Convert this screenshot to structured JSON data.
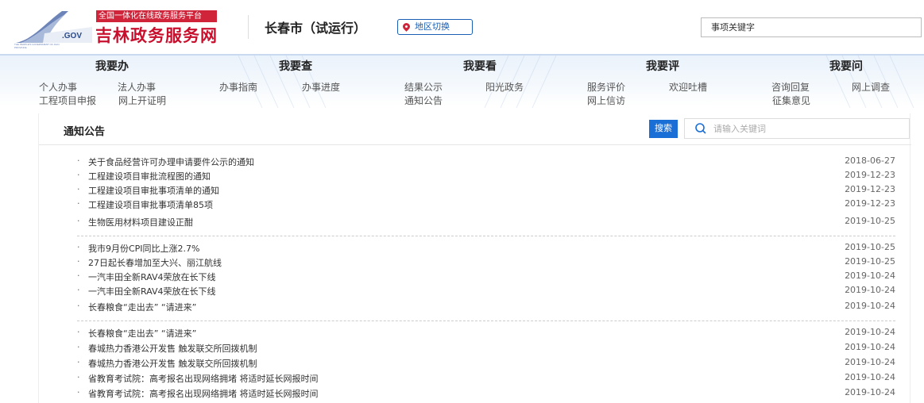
{
  "header": {
    "logo_small_text": ".GOV",
    "logo_tiny_text": "THE PEOPLE'S GOVERNMENT OF JILIN PROVINCE",
    "logo_sub": "全国一体化在线政务服务平台",
    "logo_main": "吉林政务服务网",
    "city": "长春市（试运行）",
    "region_button": "地区切换",
    "search_placeholder": "事项关键字"
  },
  "nav": {
    "categories": [
      "我要办",
      "我要查",
      "我要看",
      "我要评",
      "我要问"
    ],
    "links": {
      "ban": [
        "个人办事",
        "法人办事",
        "工程项目申报",
        "网上开证明"
      ],
      "cha": [
        "办事指南",
        "办事进度"
      ],
      "kan": [
        "结果公示",
        "阳光政务",
        "通知公告"
      ],
      "ping": [
        "服务评价",
        "欢迎吐槽",
        "网上信访"
      ],
      "wen": [
        "咨询回复",
        "网上调查",
        "征集意见"
      ]
    }
  },
  "notices": {
    "title": "通知公告",
    "search_button": "搜索",
    "search_placeholder": "请输入关键词",
    "groups": [
      [
        {
          "title": "关于食品经营许可办理申请要件公示的通知",
          "date": "2018-06-27"
        },
        {
          "title": "工程建设项目审批流程图的通知",
          "date": "2019-12-23"
        },
        {
          "title": "工程建设项目审批事项清单的通知",
          "date": "2019-12-23"
        },
        {
          "title": "工程建设项目审批事项清单85项",
          "date": "2019-12-23"
        },
        {
          "title": "生物医用材料项目建设正酣",
          "date": "2019-10-25"
        }
      ],
      [
        {
          "title": "我市9月份CPI同比上涨2.7%",
          "date": "2019-10-25"
        },
        {
          "title": "27日起长春增加至大兴、丽江航线",
          "date": "2019-10-25"
        },
        {
          "title": "一汽丰田全新RAV4荣放在长下线",
          "date": "2019-10-24"
        },
        {
          "title": "一汽丰田全新RAV4荣放在长下线",
          "date": "2019-10-24"
        },
        {
          "title": "长春粮食“走出去” “请进来”",
          "date": "2019-10-24"
        }
      ],
      [
        {
          "title": "长春粮食“走出去” “请进来”",
          "date": "2019-10-24"
        },
        {
          "title": "春城热力香港公开发售 触发联交所回拨机制",
          "date": "2019-10-24"
        },
        {
          "title": "春城热力香港公开发售 触发联交所回拨机制",
          "date": "2019-10-24"
        },
        {
          "title": "省教育考试院：高考报名出现网络拥堵 将适时延长网报时间",
          "date": "2019-10-24"
        },
        {
          "title": "省教育考试院：高考报名出现网络拥堵 将适时延长网报时间",
          "date": "2019-10-24"
        }
      ]
    ]
  },
  "colors": {
    "brand_red": "#c8102e",
    "link_blue": "#1a5fb4",
    "button_blue": "#1a6fd6"
  },
  "icons": [
    "logo-swoosh-icon",
    "location-pin-icon",
    "search-icon"
  ]
}
